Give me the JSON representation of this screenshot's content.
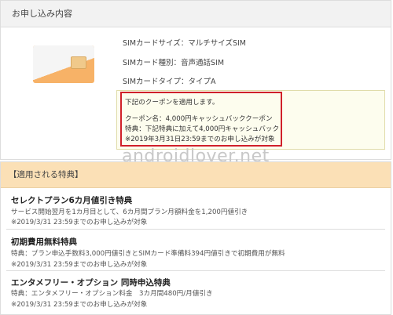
{
  "application": {
    "header": "お申し込み内容"
  },
  "sim": {
    "size": "SIMカードサイズ：マルチサイズSIM",
    "kind": "SIMカード種別：音声通話SIM",
    "type": "SIMカードタイプ：タイプA"
  },
  "coupon": {
    "intro": "下記のクーポンを適用します。",
    "name": "クーポン名：4,000円キャッシュバッククーポン",
    "benefit": "特典：下記特典に加えて4,000円キャッシュバック",
    "deadline": "※2019年3月31日23:59までのお申し込みが対象"
  },
  "watermark": "androidlover.net",
  "benefits": {
    "header": "【適用される特典】",
    "items": [
      {
        "title": "セレクトプラン6カ月値引き特典",
        "desc": "サービス開始翌月を1カ月目として、6カ月間プラン月額料金を1,200円値引き",
        "note": "※2019/3/31 23:59までのお申し込みが対象"
      },
      {
        "title": "初期費用無料特典",
        "desc": "特典：プラン申込手数料3,000円値引きとSIMカード準備料394円値引きで初期費用が無料",
        "note": "※2019/3/31 23:59までのお申し込みが対象"
      },
      {
        "title": "エンタメフリー・オプション 同時申込特典",
        "desc": "特典：エンタメフリー・オプション料金　3カ月間480円/月値引き",
        "note": "※2019/3/31 23:59までのお申し込みが対象"
      }
    ]
  }
}
